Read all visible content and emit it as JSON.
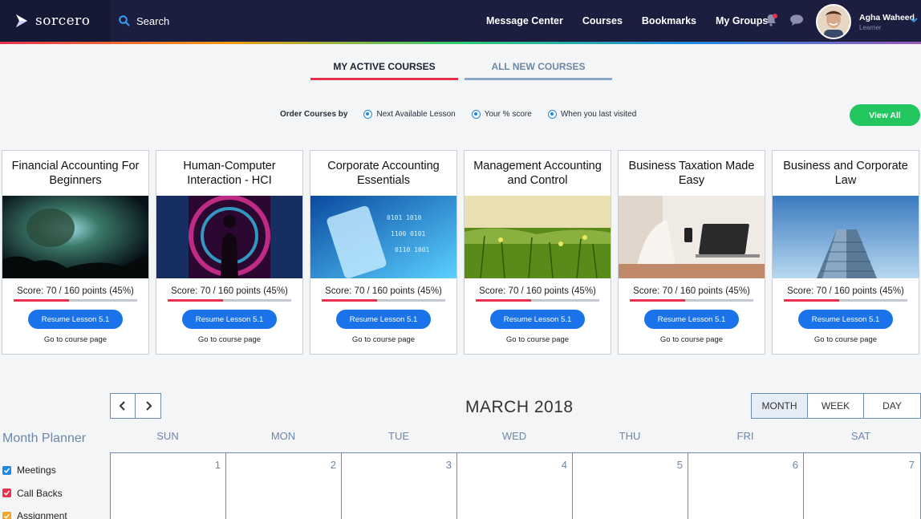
{
  "brand": {
    "name": "sorcero"
  },
  "search": {
    "label": "Search"
  },
  "nav": {
    "links": [
      "Message Center",
      "Courses",
      "Bookmarks",
      "My Groups"
    ]
  },
  "user": {
    "name": "Agha Waheed",
    "role": "Learner"
  },
  "tabs": {
    "active": "MY ACTIVE COURSES",
    "inactive": "ALL NEW COURSES"
  },
  "order": {
    "label": "Order Courses by",
    "options": [
      "Next Available Lesson",
      "Your % score",
      "When you last visited"
    ],
    "view_all": "View All"
  },
  "courses": [
    {
      "title": "Financial Accounting For Beginners",
      "score": "Score: 70 / 160 points (45%)",
      "progress": 0.45,
      "button": "Resume Lesson 5.1",
      "link": "Go to course page"
    },
    {
      "title": "Human-Computer Interaction - HCI",
      "score": "Score: 70 / 160 points (45%)",
      "progress": 0.45,
      "button": "Resume Lesson 5.1",
      "link": "Go to course page"
    },
    {
      "title": "Corporate Accounting Essentials",
      "score": "Score: 70 / 160 points (45%)",
      "progress": 0.45,
      "button": "Resume Lesson 5.1",
      "link": "Go to course page"
    },
    {
      "title": "Management Accounting and Control",
      "score": "Score: 70 / 160 points (45%)",
      "progress": 0.45,
      "button": "Resume Lesson 5.1",
      "link": "Go to course page"
    },
    {
      "title": "Business Taxation Made Easy",
      "score": "Score: 70 / 160 points (45%)",
      "progress": 0.45,
      "button": "Resume Lesson 5.1",
      "link": "Go to course page"
    },
    {
      "title": "Business and Corporate Law",
      "score": "Score: 70 / 160 points (45%)",
      "progress": 0.45,
      "button": "Resume Lesson 5.1",
      "link": "Go to course page"
    }
  ],
  "calendar": {
    "title": "MARCH 2018",
    "views": [
      "MONTH",
      "WEEK",
      "DAY"
    ],
    "weekdays": [
      "SUN",
      "MON",
      "TUE",
      "WED",
      "THU",
      "FRI",
      "SAT"
    ],
    "first_week": [
      "1",
      "2",
      "3",
      "4",
      "5",
      "6",
      "7"
    ]
  },
  "planner": {
    "title": "Month Planner",
    "items": [
      {
        "label": "Meetings",
        "color": "#1e88e5"
      },
      {
        "label": "Call Backs",
        "color": "#e8324f"
      },
      {
        "label": "Assignment",
        "color": "#f5a623"
      }
    ]
  },
  "colors": {
    "accent": "#e8324f",
    "primary": "#1a73e8",
    "success": "#22c55e",
    "nav_bg": "#1b1e3f"
  }
}
